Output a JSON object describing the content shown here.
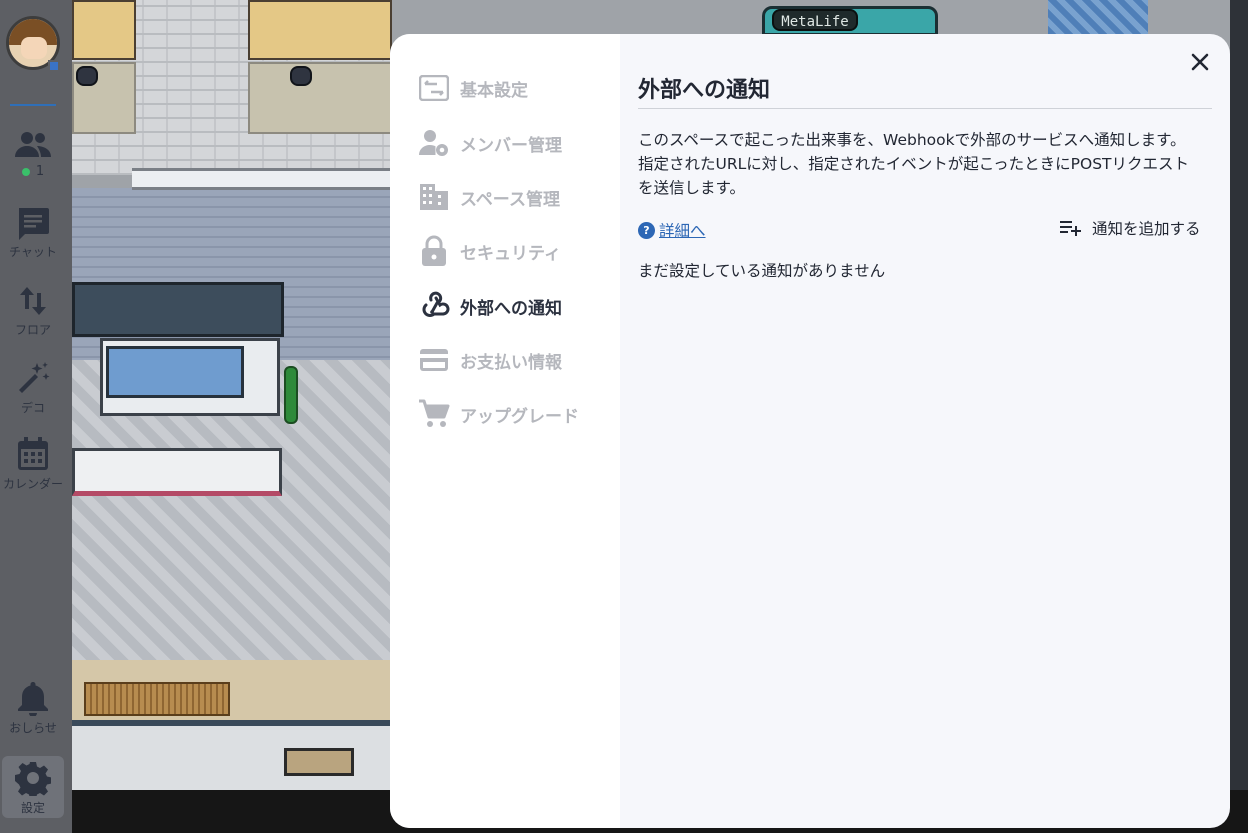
{
  "map": {
    "sign_label": "MetaLife"
  },
  "left_rail": {
    "online_count": "1",
    "items": [
      {
        "label": "",
        "icon": "people-icon"
      },
      {
        "label": "チャット",
        "icon": "chat-icon"
      },
      {
        "label": "フロア",
        "icon": "floor-switch-icon"
      },
      {
        "label": "デコ",
        "icon": "magic-wand-icon"
      },
      {
        "label": "カレンダー",
        "icon": "calendar-icon"
      },
      {
        "label": "おしらせ",
        "icon": "bell-icon"
      },
      {
        "label": "設定",
        "icon": "gear-icon"
      }
    ]
  },
  "settings": {
    "menu": [
      {
        "label": "基本設定",
        "icon": "settings-panel-icon",
        "active": false
      },
      {
        "label": "メンバー管理",
        "icon": "member-settings-icon",
        "active": false
      },
      {
        "label": "スペース管理",
        "icon": "building-icon",
        "active": false
      },
      {
        "label": "セキュリティ",
        "icon": "lock-icon",
        "active": false
      },
      {
        "label": "外部への通知",
        "icon": "webhook-icon",
        "active": true
      },
      {
        "label": "お支払い情報",
        "icon": "credit-card-icon",
        "active": false
      },
      {
        "label": "アップグレード",
        "icon": "cart-icon",
        "active": false
      }
    ],
    "page": {
      "title": "外部への通知",
      "description_lines": [
        "このスペースで起こった出来事を、Webhookで外部のサービスへ通知します。",
        "指定されたURLに対し、指定されたイベントが起こったときにPOSTリクエスト",
        "を送信します。"
      ],
      "details_link": "詳細へ",
      "add_button": "通知を追加する",
      "empty_message": "まだ設定している通知がありません"
    }
  },
  "colors": {
    "link": "#2d67b5",
    "active_text": "#2c3240",
    "inactive_text": "#b5b7bd",
    "online_dot": "#3ac06a"
  }
}
